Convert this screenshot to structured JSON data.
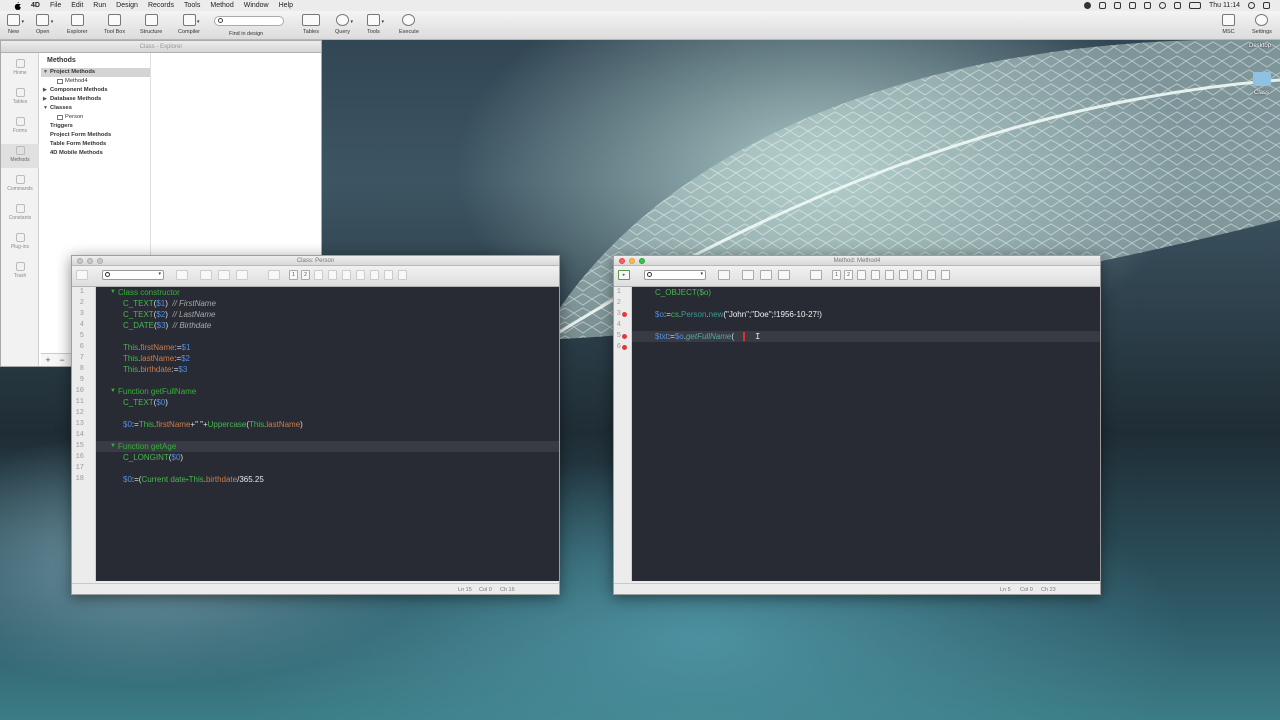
{
  "menubar": {
    "app": "4D",
    "items": [
      "File",
      "Edit",
      "Run",
      "Design",
      "Records",
      "Tools",
      "Method",
      "Window",
      "Help"
    ],
    "clock": "Thu 11:14"
  },
  "toolbar": {
    "new": "New",
    "open": "Open",
    "explorer": "Explorer",
    "toolbox": "Tool Box",
    "structure": "Structure",
    "compiler": "Compiler",
    "find_label": "Find in design",
    "tables": "Tables",
    "query": "Query",
    "tools": "Tools",
    "execute": "Execute",
    "msc": "MSC",
    "settings": "Settings"
  },
  "desktop": {
    "label_desktop": "Desktop",
    "label_class": "Class"
  },
  "explorer": {
    "title": "Class - Explorer",
    "tabs": [
      "Home",
      "Tables",
      "Forms",
      "Methods",
      "Commands",
      "Constants",
      "Plug-ins",
      "Trash"
    ],
    "list_header": "Methods",
    "nodes": [
      "Project Methods",
      "Method4",
      "Component Methods",
      "Database Methods",
      "Classes",
      "Person",
      "Triggers",
      "Project Form Methods",
      "Table Form Methods",
      "4D Mobile Methods"
    ],
    "footer": [
      "+",
      "−"
    ]
  },
  "class_window": {
    "title": "Class: Person",
    "status": {
      "ln": "Ln 15",
      "col": "Col 0",
      "ch": "Ch 16"
    },
    "line_numbers": [
      "1",
      "2",
      "3",
      "4",
      "5",
      "6",
      "7",
      "8",
      "9",
      "10",
      "11",
      "12",
      "13",
      "14",
      "15",
      "16",
      "17",
      "18"
    ],
    "code": {
      "l1": "Class constructor",
      "l2a": "C_TEXT",
      "l2b": "$1",
      "l2c": "// FirstName",
      "l3a": "C_TEXT",
      "l3b": "$2",
      "l3c": "// LastName",
      "l4a": "C_DATE",
      "l4b": "$3",
      "l4c": "// Birthdate",
      "l6a": "This",
      "l6b": "firstName",
      "l6c": "$1",
      "l7a": "This",
      "l7b": "lastName",
      "l7c": "$2",
      "l8a": "This",
      "l8b": "birthdate",
      "l8c": "$3",
      "l10": "Function getFullName",
      "l11a": "C_TEXT",
      "l11b": "$0",
      "l13a": "$0",
      "l13b": "This",
      "l13c": "firstName",
      "l13d": "\" \"",
      "l13e": "Uppercase",
      "l13f": "This",
      "l13g": "lastName",
      "l15": "Function getAge",
      "l16a": "C_LONGINT",
      "l16b": "$0",
      "l18a": "$0",
      "l18b": "Current date",
      "l18c": "This",
      "l18d": "birthdate",
      "l18e": "/365.25"
    }
  },
  "method_window": {
    "title": "Method: Method4",
    "status": {
      "ln": "Ln 5",
      "col": "Col 0",
      "ch": "Ch 23"
    },
    "line_numbers": [
      "1",
      "2",
      "3",
      "4",
      "5",
      "6"
    ],
    "code": {
      "l1": "C_OBJECT($o)",
      "l3a": "$o",
      "l3b": "cs",
      "l3c": "Person",
      "l3d": "new",
      "l3e": "(\"John\";\"Doe\";!1956-10-27!)",
      "l5a": "$txt",
      "l5b": "$o",
      "l5c": "getFullName",
      "l5d": "("
    }
  }
}
